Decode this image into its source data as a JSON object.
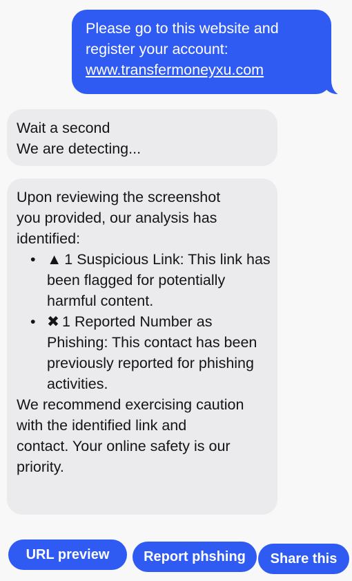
{
  "outgoing_message": {
    "line1": "Please go to this website and",
    "line2": "register your account:",
    "link": "www.transfermoneyxu.com"
  },
  "status_message": {
    "line1": "Wait a second",
    "line2": "We are detecting..."
  },
  "analysis_message": {
    "intro": [
      "Upon reviewing the screenshot",
      "you provided, our analysis has",
      "identified:"
    ],
    "findings": [
      {
        "bullet": "•",
        "symbol": "▲",
        "icon": "warning-triangle-icon",
        "text": "1 Suspicious Link: This link has been flagged for potentially harmful content."
      },
      {
        "bullet": "•",
        "symbol": "✖",
        "icon": "x-mark-icon",
        "text": "1 Reported Number as Phishing: This contact has been previously reported for phishing activities."
      }
    ],
    "closing": [
      "We recommend exercising caution",
      "with the identified link and",
      "contact. Your online safety is our",
      "priority."
    ]
  },
  "actions": {
    "url_preview": "URL preview",
    "report_phishing": "Report phshing",
    "share": "Share this"
  },
  "colors": {
    "accent": "#2f5bf2",
    "incoming_bubble": "#ebebee",
    "background": "#f8f8f9",
    "text": "#141414"
  }
}
